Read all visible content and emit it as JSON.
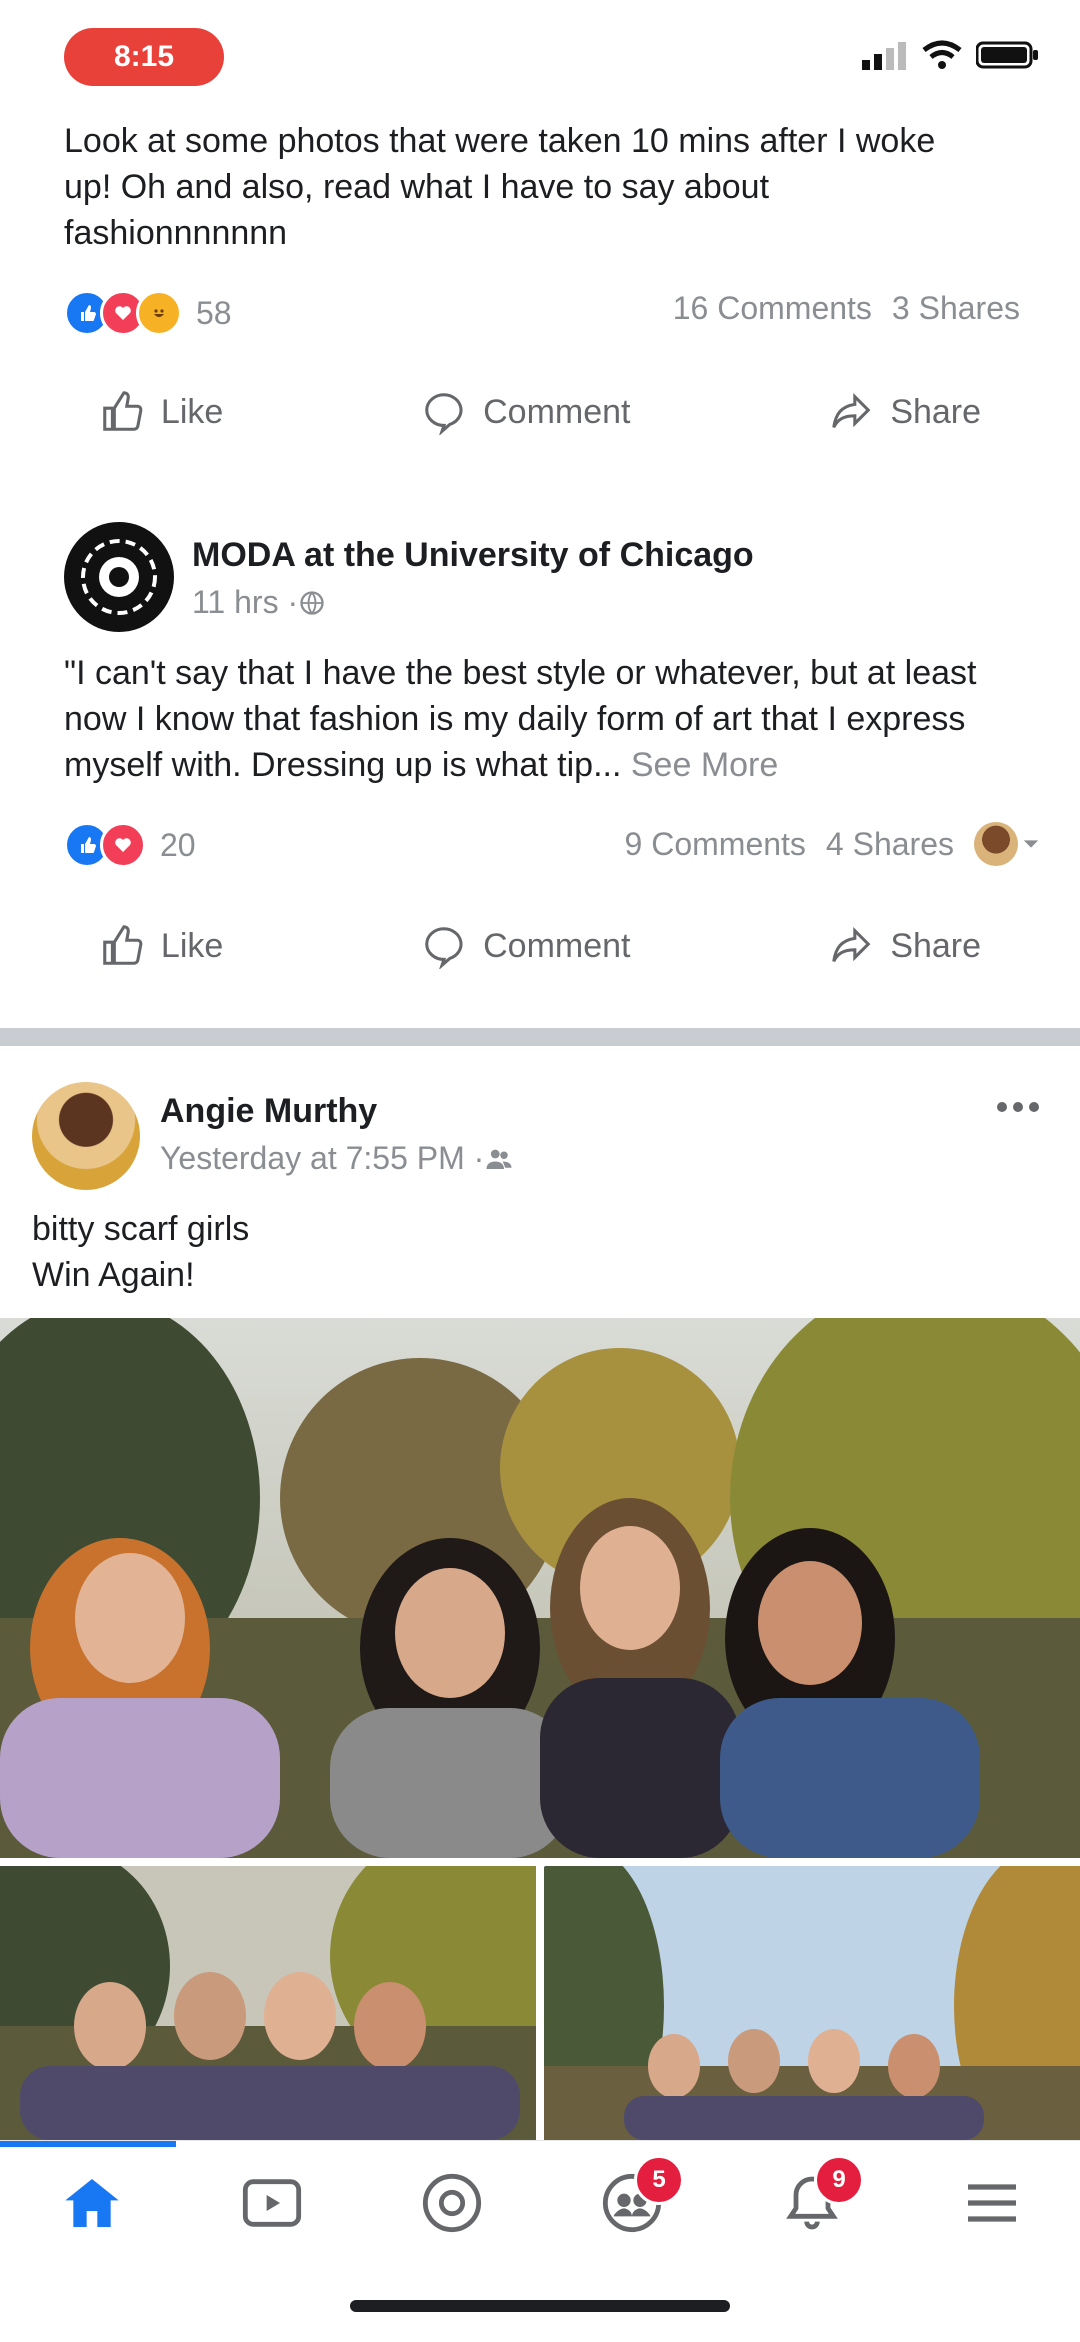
{
  "status_bar": {
    "time": "8:15"
  },
  "post1": {
    "text": "Look at some photos that were taken 10 mins after I woke up! Oh and also, read what I have to say about fashionnnnnnn",
    "reactions_count": "58",
    "comments": "16 Comments",
    "shares": "3 Shares"
  },
  "post2": {
    "author": "MODA at the University of Chicago",
    "time": "11 hrs · ",
    "text": "\"I can't say that I have the best style or whatever, but at least now I know that fashion is my daily form of art that I express myself with. Dressing up is what tip...",
    "see_more": "See More",
    "reactions_count": "20",
    "comments": "9 Comments",
    "shares": "4 Shares"
  },
  "actions": {
    "like": "Like",
    "comment": "Comment",
    "share": "Share"
  },
  "post3": {
    "author": "Angie Murthy",
    "time": "Yesterday at 7:55 PM · ",
    "line1": "bitty scarf girls",
    "line2": "Win Again!"
  },
  "tabbar": {
    "badges": {
      "groups": "5",
      "notifications": "9"
    }
  },
  "colors": {
    "brand_blue": "#1877f2",
    "badge_red": "#e41e3f",
    "status_pill": "#e8413a"
  }
}
